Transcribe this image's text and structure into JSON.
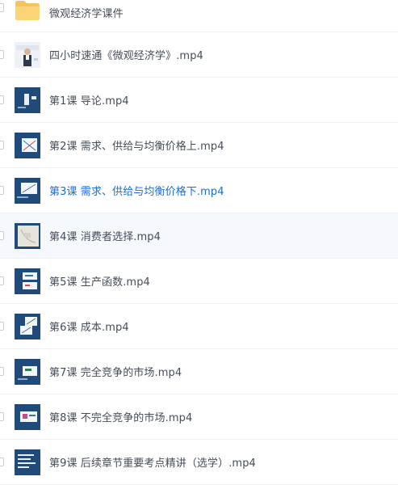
{
  "files": [
    {
      "name": "微观经济学课件",
      "icon": "folder-icon"
    },
    {
      "name": "四小时速通《微观经济学》.mp4",
      "icon": "video-thumbnail-presenter"
    },
    {
      "name": "第1课 导论.mp4",
      "icon": "video-thumbnail-slide"
    },
    {
      "name": "第2课 需求、供给与均衡价格上.mp4",
      "icon": "video-thumbnail-slide"
    },
    {
      "name": "第3课 需求、供给与均衡价格下.mp4",
      "icon": "video-thumbnail-slide",
      "active": true
    },
    {
      "name": "第4课 消费者选择.mp4",
      "icon": "video-thumbnail-slide",
      "hovered": true
    },
    {
      "name": "第5课 生产函数.mp4",
      "icon": "video-thumbnail-slide"
    },
    {
      "name": "第6课 成本.mp4",
      "icon": "video-thumbnail-slide"
    },
    {
      "name": "第7课 完全竞争的市场.mp4",
      "icon": "video-thumbnail-slide"
    },
    {
      "name": "第8课 不完全竞争的市场.mp4",
      "icon": "video-thumbnail-slide"
    },
    {
      "name": "第9课 后续章节重要考点精讲（选学）.mp4",
      "icon": "video-thumbnail-slide"
    }
  ],
  "colors": {
    "active_text": "#1a6cd8",
    "text": "#454d5a",
    "hover_bg": "#f5f8fd",
    "thumb_bg": "#1f4a7a",
    "folder": "#f7c35a"
  }
}
